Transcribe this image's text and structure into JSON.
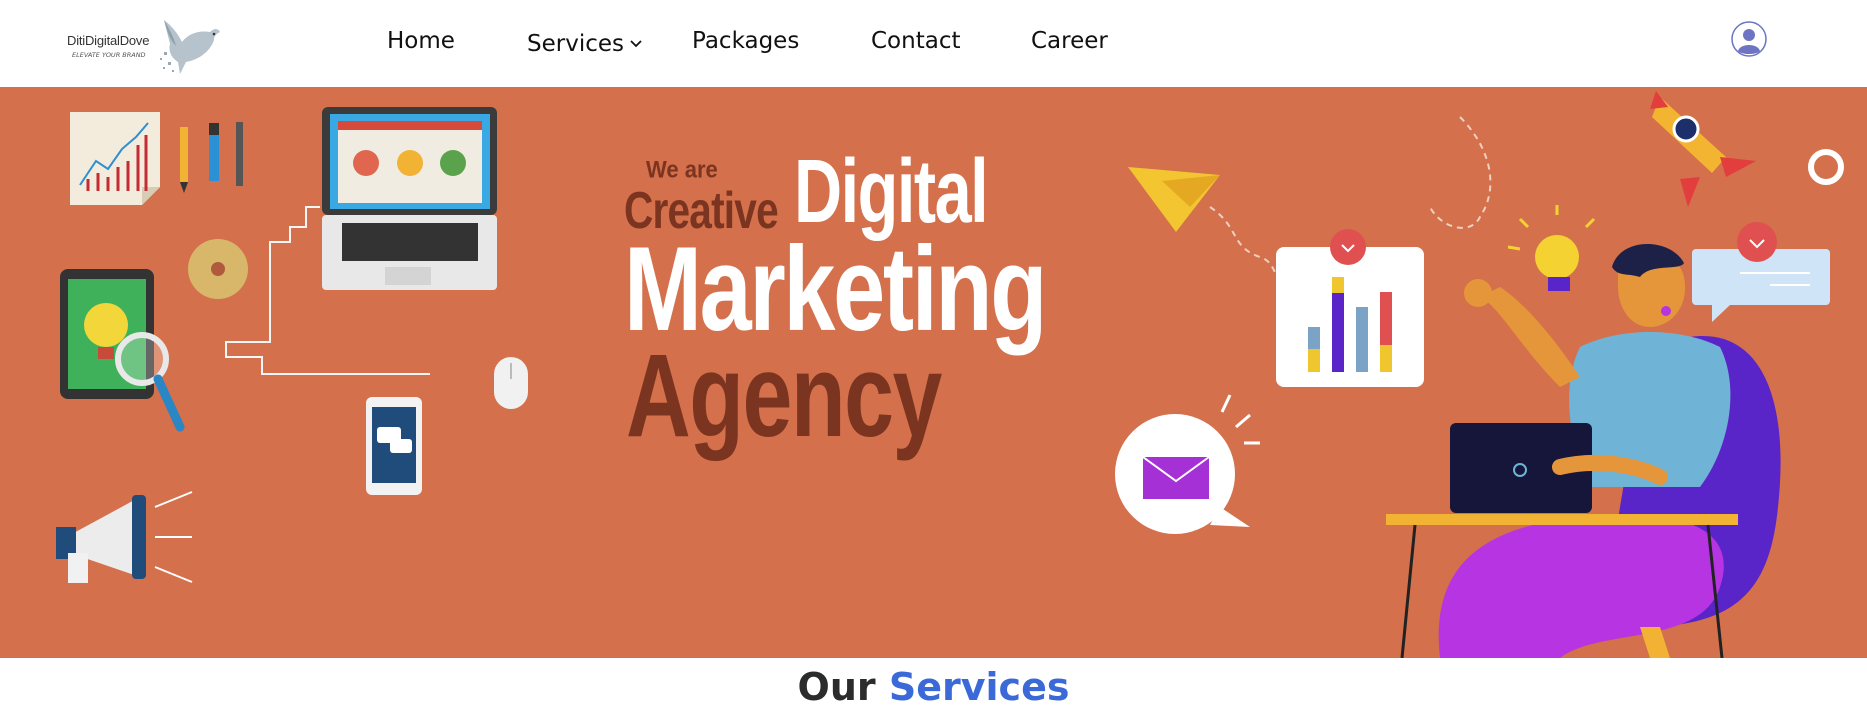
{
  "brand": {
    "name": "DitiDigitalDove",
    "tagline": "ELEVATE YOUR BRAND"
  },
  "nav": {
    "items": [
      {
        "label": "Home"
      },
      {
        "label": "Services"
      },
      {
        "label": "Packages"
      },
      {
        "label": "Contact"
      },
      {
        "label": "Career"
      }
    ]
  },
  "hero": {
    "we_are": "We are",
    "creative": "Creative",
    "digital": "Digital",
    "marketing": "Marketing",
    "agency": "Agency",
    "background_color": "#d4704b"
  },
  "section": {
    "title_part1": "Our",
    "title_part2": "Services"
  },
  "icons": [
    "dove-logo-icon",
    "chevron-down-icon",
    "user-avatar-icon",
    "line-chart-icon",
    "pencil-icon",
    "laptop-icon",
    "cd-icon",
    "tablet-lightbulb-icon",
    "magnifier-icon",
    "earphones-icon",
    "mouse-icon",
    "phone-chat-icon",
    "megaphone-icon",
    "paper-plane-icon",
    "rocket-icon",
    "bar-chart-card-icon",
    "mail-bubble-icon",
    "chat-bubble-icon",
    "lightbulb-icon",
    "person-at-desk-illustration"
  ],
  "colors": {
    "accent": "#3b6ad8",
    "heading_dark": "#2b2b2b",
    "hero_dark": "#7b3420"
  }
}
